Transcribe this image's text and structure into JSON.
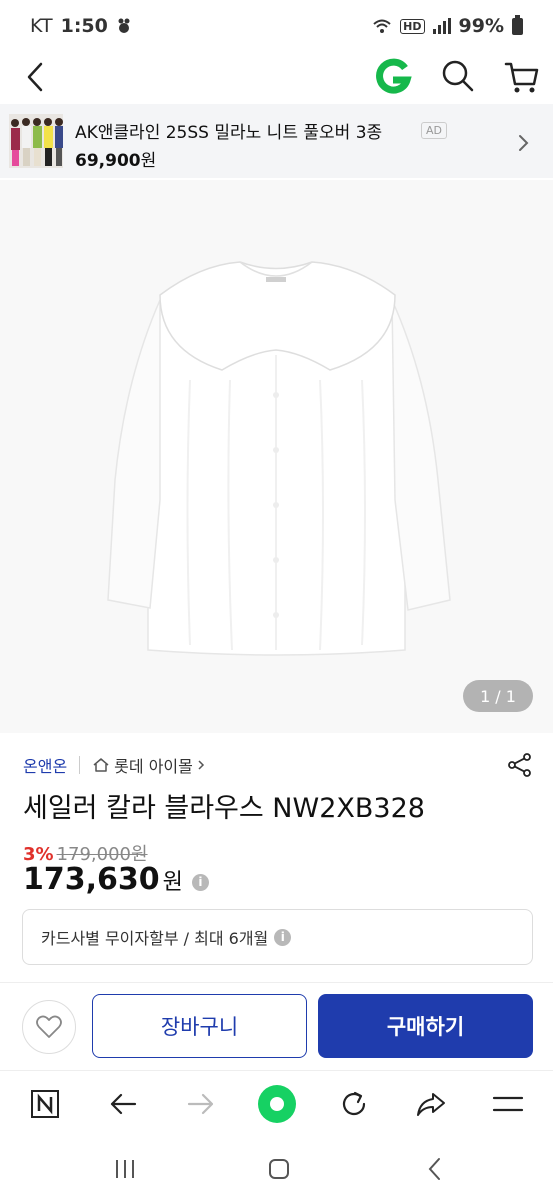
{
  "status_bar": {
    "carrier": "KT",
    "time": "1:50",
    "hd": "HD",
    "battery": "99%"
  },
  "ad": {
    "title": "AK앤클라인 25SS 밀라노 니트 풀오버 3종",
    "badge": "AD",
    "price": "69,900",
    "price_unit": "원"
  },
  "product": {
    "image_counter": {
      "current": "1",
      "sep": "/",
      "total": "1"
    },
    "brand": "온앤온",
    "store": "롯데 아이몰",
    "title": "세일러 칼라 블라우스 NW2XB328",
    "discount_rate": "3%",
    "original_price": "179,000원",
    "price": "173,630",
    "price_unit": "원",
    "installment": "카드사별 무이자할부 / 최대 6개월"
  },
  "actions": {
    "cart_label": "장바구니",
    "buy_label": "구매하기"
  },
  "colors": {
    "brand_blue": "#1f3cad",
    "discount_red": "#e0312b",
    "gmarket_green": "#16b84b"
  }
}
